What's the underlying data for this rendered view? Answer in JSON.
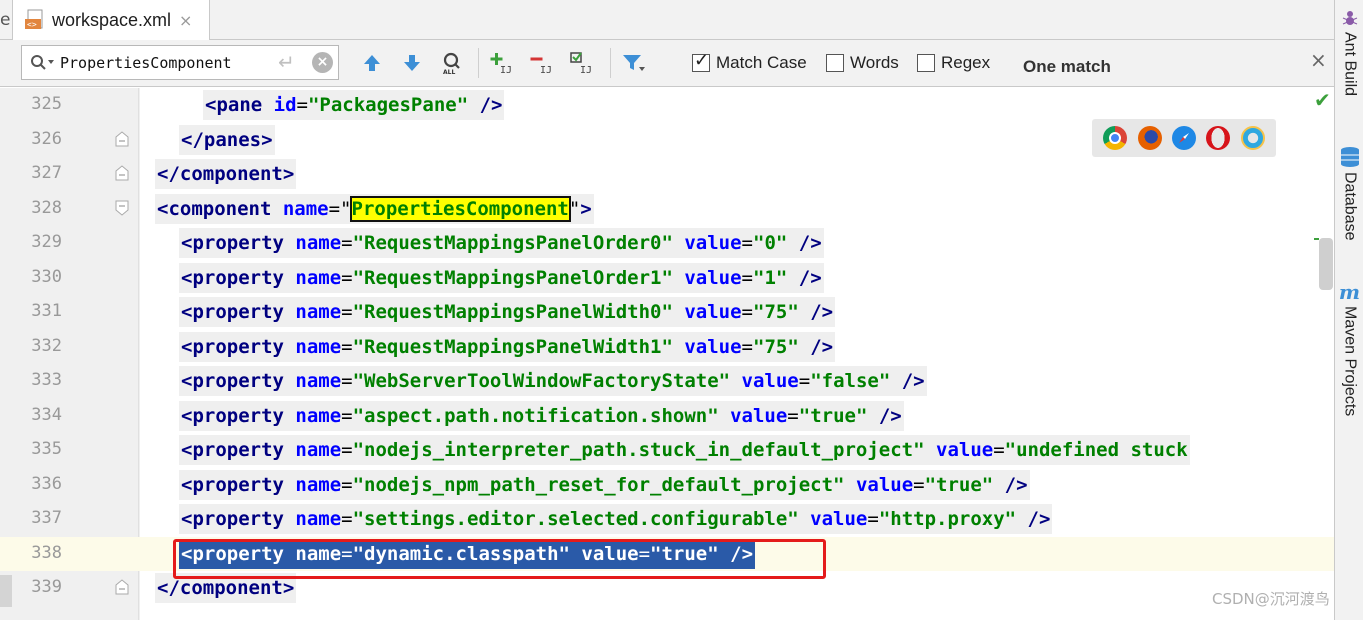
{
  "tabbar": {
    "left_cut_text": "e",
    "tab": {
      "title": "workspace.xml",
      "close": "×"
    }
  },
  "search": {
    "query": "PropertiesComponent",
    "checkboxes": [
      {
        "label": "Match Case",
        "checked": true
      },
      {
        "label": "Words",
        "checked": false
      },
      {
        "label": "Regex",
        "checked": false
      }
    ],
    "result": "One match",
    "close": "×"
  },
  "editor": {
    "lines": [
      {
        "no": "325",
        "parts": [
          [
            "t",
            "<pane "
          ],
          [
            "a",
            "id"
          ],
          [
            "p",
            "="
          ],
          [
            "v",
            "\"PackagesPane\""
          ],
          [
            "t",
            " />"
          ]
        ]
      },
      {
        "no": "326",
        "parts": [
          [
            "t",
            "</panes>"
          ]
        ]
      },
      {
        "no": "327",
        "parts": [
          [
            "t",
            "</component>"
          ]
        ]
      },
      {
        "no": "328",
        "parts": [
          [
            "t",
            "<component "
          ],
          [
            "a",
            "name"
          ],
          [
            "p",
            "=\""
          ],
          [
            "hit",
            "PropertiesComponent"
          ],
          [
            "p",
            "\""
          ],
          [
            "t",
            ">"
          ]
        ]
      },
      {
        "no": "329",
        "parts": [
          [
            "t",
            "<property "
          ],
          [
            "a",
            "name"
          ],
          [
            "p",
            "="
          ],
          [
            "v",
            "\"RequestMappingsPanelOrder0\""
          ],
          [
            "a",
            " value"
          ],
          [
            "p",
            "="
          ],
          [
            "v",
            "\"0\""
          ],
          [
            "t",
            " />"
          ]
        ]
      },
      {
        "no": "330",
        "parts": [
          [
            "t",
            "<property "
          ],
          [
            "a",
            "name"
          ],
          [
            "p",
            "="
          ],
          [
            "v",
            "\"RequestMappingsPanelOrder1\""
          ],
          [
            "a",
            " value"
          ],
          [
            "p",
            "="
          ],
          [
            "v",
            "\"1\""
          ],
          [
            "t",
            " />"
          ]
        ]
      },
      {
        "no": "331",
        "parts": [
          [
            "t",
            "<property "
          ],
          [
            "a",
            "name"
          ],
          [
            "p",
            "="
          ],
          [
            "v",
            "\"RequestMappingsPanelWidth0\""
          ],
          [
            "a",
            " value"
          ],
          [
            "p",
            "="
          ],
          [
            "v",
            "\"75\""
          ],
          [
            "t",
            " />"
          ]
        ]
      },
      {
        "no": "332",
        "parts": [
          [
            "t",
            "<property "
          ],
          [
            "a",
            "name"
          ],
          [
            "p",
            "="
          ],
          [
            "v",
            "\"RequestMappingsPanelWidth1\""
          ],
          [
            "a",
            " value"
          ],
          [
            "p",
            "="
          ],
          [
            "v",
            "\"75\""
          ],
          [
            "t",
            " />"
          ]
        ]
      },
      {
        "no": "333",
        "parts": [
          [
            "t",
            "<property "
          ],
          [
            "a",
            "name"
          ],
          [
            "p",
            "="
          ],
          [
            "v",
            "\"WebServerToolWindowFactoryState\""
          ],
          [
            "a",
            " value"
          ],
          [
            "p",
            "="
          ],
          [
            "v",
            "\"false\""
          ],
          [
            "t",
            " />"
          ]
        ]
      },
      {
        "no": "334",
        "parts": [
          [
            "t",
            "<property "
          ],
          [
            "a",
            "name"
          ],
          [
            "p",
            "="
          ],
          [
            "v",
            "\"aspect.path.notification.shown\""
          ],
          [
            "a",
            " value"
          ],
          [
            "p",
            "="
          ],
          [
            "v",
            "\"true\""
          ],
          [
            "t",
            " />"
          ]
        ]
      },
      {
        "no": "335",
        "parts": [
          [
            "t",
            "<property "
          ],
          [
            "a",
            "name"
          ],
          [
            "p",
            "="
          ],
          [
            "v",
            "\"nodejs_interpreter_path.stuck_in_default_project\""
          ],
          [
            "a",
            " value"
          ],
          [
            "p",
            "="
          ],
          [
            "v",
            "\"undefined stuck"
          ]
        ]
      },
      {
        "no": "336",
        "parts": [
          [
            "t",
            "<property "
          ],
          [
            "a",
            "name"
          ],
          [
            "p",
            "="
          ],
          [
            "v",
            "\"nodejs_npm_path_reset_for_default_project\""
          ],
          [
            "a",
            " value"
          ],
          [
            "p",
            "="
          ],
          [
            "v",
            "\"true\""
          ],
          [
            "t",
            " />"
          ]
        ]
      },
      {
        "no": "337",
        "parts": [
          [
            "t",
            "<property "
          ],
          [
            "a",
            "name"
          ],
          [
            "p",
            "="
          ],
          [
            "v",
            "\"settings.editor.selected.configurable\""
          ],
          [
            "a",
            " value"
          ],
          [
            "p",
            "="
          ],
          [
            "v",
            "\"http.proxy\""
          ],
          [
            "t",
            " />"
          ]
        ]
      },
      {
        "no": "338",
        "parts": [
          [
            "t",
            "<property "
          ],
          [
            "a",
            "name"
          ],
          [
            "p",
            "="
          ],
          [
            "v",
            "\"dynamic.classpath\""
          ],
          [
            "a",
            " value"
          ],
          [
            "p",
            "="
          ],
          [
            "v",
            "\"true\""
          ],
          [
            "t",
            " />"
          ]
        ]
      },
      {
        "no": "339",
        "parts": [
          [
            "t",
            "</component>"
          ]
        ]
      }
    ]
  },
  "browsers": [
    "chrome-icon",
    "firefox-icon",
    "safari-icon",
    "opera-icon",
    "ie-icon"
  ],
  "watermark": "CSDN@沉河渡鸟",
  "right_tools": [
    {
      "label": "Ant Build"
    },
    {
      "label": "Database"
    },
    {
      "label": "Maven Projects"
    }
  ],
  "colors": {
    "tag": "#000080",
    "attribute": "#0000ff",
    "value": "#008000",
    "search_hit": "#ffff00",
    "selection": "#2a5aa8",
    "callout": "#e41b1b"
  }
}
